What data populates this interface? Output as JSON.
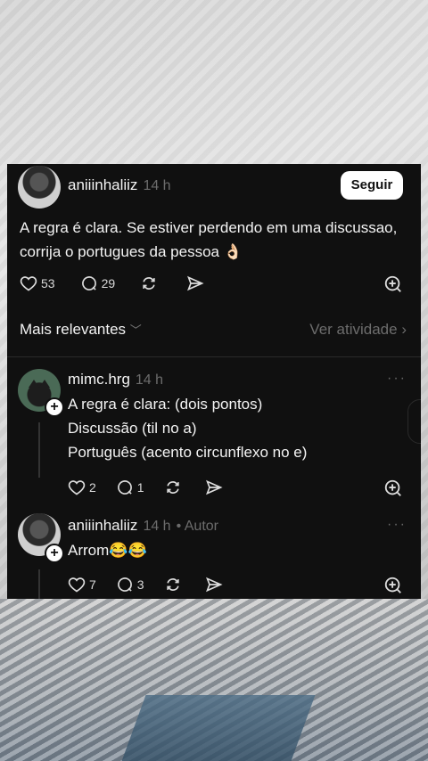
{
  "post": {
    "username": "aniiinhaliiz",
    "time": "14 h",
    "follow_label": "Seguir",
    "text": "A regra é clara. Se estiver perdendo em uma discussao, corrija o portugues da pessoa 👌🏻",
    "likes": "53",
    "comments": "29"
  },
  "sort": {
    "label": "Mais relevantes",
    "activity_label": "Ver atividade"
  },
  "replies": [
    {
      "username": "mimc.hrg",
      "time": "14 h",
      "lines": [
        "A regra é clara: (dois pontos)",
        "Discussão (til no a)",
        "Português (acento circunflexo no e)"
      ],
      "likes": "2",
      "comments": "1"
    },
    {
      "username": "aniiinhaliiz",
      "time": "14 h",
      "author_tag": "• Autor",
      "text": "Arrom😂😂",
      "likes": "7",
      "comments": "3"
    }
  ],
  "icons": [
    "heart-icon",
    "comment-icon",
    "repost-icon",
    "share-icon",
    "save-icon",
    "more-icon",
    "chevron-down-icon",
    "chevron-right-icon"
  ]
}
